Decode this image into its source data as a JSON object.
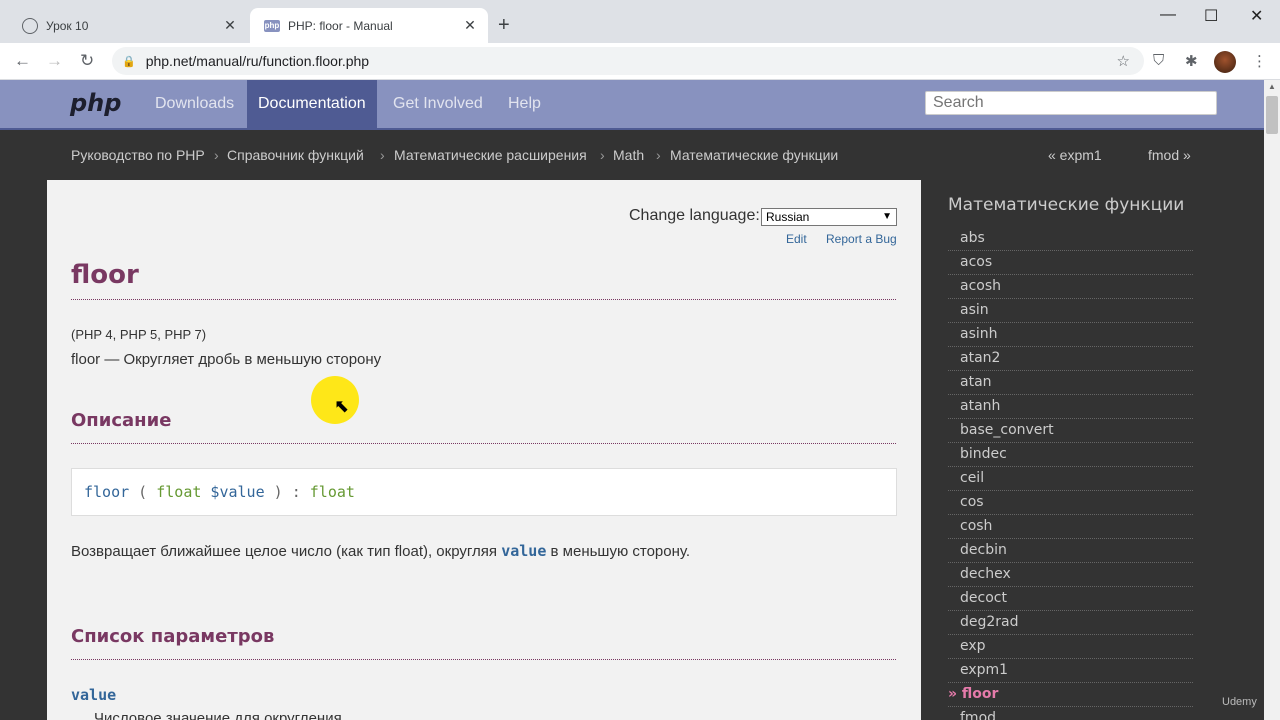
{
  "browser": {
    "tabs": [
      {
        "title": "Урок 10",
        "close": "✕"
      },
      {
        "title": "PHP: floor - Manual",
        "favicon": "php",
        "close": "✕"
      }
    ],
    "new_tab": "+",
    "window_controls": {
      "minimize": "—",
      "maximize": "☐",
      "close": "✕"
    },
    "nav": {
      "back": "←",
      "forward": "→",
      "reload": "↻"
    },
    "url": "php.net/manual/ru/function.floor.php",
    "lock_icon": "🔒",
    "star_icon": "☆"
  },
  "site": {
    "logo": "php",
    "nav_links": [
      "Downloads",
      "Documentation",
      "Get Involved",
      "Help"
    ],
    "active_nav": "Documentation",
    "search_placeholder": "Search",
    "breadcrumbs": [
      "Руководство по PHP",
      "Справочник функций",
      "Математические расширения",
      "Math",
      "Математические функции"
    ],
    "breadcrumb_sep": "›",
    "prev_link": "« expm1",
    "next_link": "fmod »"
  },
  "page": {
    "change_language_label": "Change language:",
    "language_selected": "Russian",
    "edit_link": "Edit",
    "report_bug_link": "Report a Bug",
    "title": "floor",
    "version": "(PHP 4, PHP 5, PHP 7)",
    "refpurpose": "floor — Округляет дробь в меньшую сторону",
    "description_heading": "Описание",
    "synopsis": {
      "fn": "floor",
      "open": " ( ",
      "type": "float",
      "param": " $value",
      "close": " ) : ",
      "return_type": "float"
    },
    "return_text_before": "Возвращает ближайшее целое число (как тип float), округляя ",
    "return_text_code": "value",
    "return_text_after": " в меньшую сторону.",
    "params_heading": "Список параметров",
    "param_name": "value",
    "param_desc": "Числовое значение для округления"
  },
  "sidebar": {
    "title": "Математические функции",
    "items": [
      "abs",
      "acos",
      "acosh",
      "asin",
      "asinh",
      "atan2",
      "atan",
      "atanh",
      "base_convert",
      "bindec",
      "ceil",
      "cos",
      "cosh",
      "decbin",
      "dechex",
      "decoct",
      "deg2rad",
      "exp",
      "expm1",
      "» floor",
      "fmod"
    ],
    "current": "» floor"
  },
  "watermark": "Udemy",
  "colors": {
    "php_nav": "#8892bf",
    "php_nav_active": "#4f5b93",
    "heading": "#793862",
    "link": "#369"
  }
}
